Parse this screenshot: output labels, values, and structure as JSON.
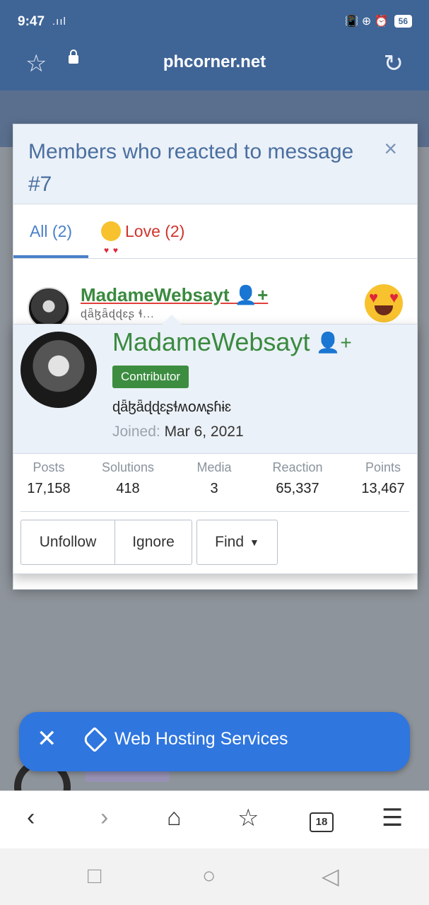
{
  "status": {
    "time": "9:47",
    "signal": ".ııl",
    "right_icons": "📳 ⊕ ⏰",
    "battery": "56"
  },
  "browser": {
    "domain": "phcorner.net"
  },
  "modal": {
    "title": "Members who reacted to message #7",
    "close": "×",
    "tabs": [
      {
        "label": "All (2)"
      },
      {
        "label": "Love (2)"
      }
    ]
  },
  "member": {
    "name": "MadameWebsayt",
    "sub": "ɖǟɮǟɖɖɛʂ ɬ..."
  },
  "card": {
    "name": "MadameWebsayt",
    "badge": "Contributor",
    "custom_title": "ɖǟɮǟɖɖɛʂɬʍօʍʂɦɨɛ",
    "joined_label": "Joined:",
    "joined_value": "Mar 6, 2021",
    "stats": [
      {
        "label": "Posts",
        "value": "17,158"
      },
      {
        "label": "Solutions",
        "value": "418"
      },
      {
        "label": "Media",
        "value": "3"
      },
      {
        "label": "Reaction",
        "value": "65,337"
      },
      {
        "label": "Points",
        "value": "13,467"
      }
    ],
    "buttons": {
      "unfollow": "Unfollow",
      "ignore": "Ignore",
      "find": "Find"
    }
  },
  "promo": {
    "label": "Web Hosting Services"
  },
  "nav": {
    "tabs_count": "18"
  }
}
